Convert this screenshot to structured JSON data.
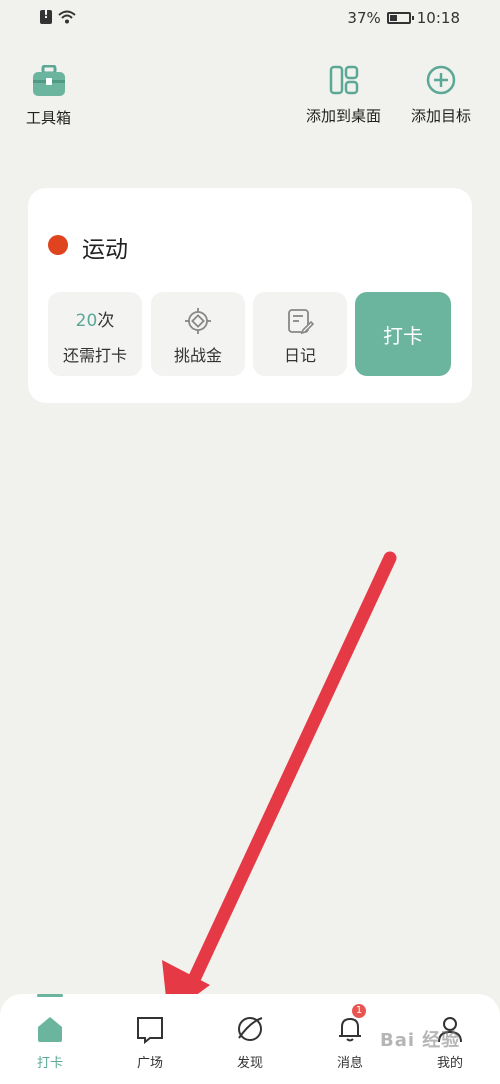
{
  "status": {
    "battery_text": "37%",
    "battery_level": 0.37,
    "time": "10:18"
  },
  "header": {
    "toolbox_label": "工具箱",
    "add_to_desktop_label": "添加到桌面",
    "add_goal_label": "添加目标"
  },
  "goal": {
    "name": "运动",
    "dot_color": "#e0441e",
    "remaining_count": "20",
    "remaining_unit": "次",
    "remaining_label": "还需打卡",
    "challenge_label": "挑战金",
    "diary_label": "日记",
    "checkin_label": "打卡"
  },
  "tabbar": {
    "items": [
      {
        "label": "打卡",
        "icon": "home-icon"
      },
      {
        "label": "广场",
        "icon": "bookmark-icon"
      },
      {
        "label": "发现",
        "icon": "planet-icon"
      },
      {
        "label": "消息",
        "icon": "bell-icon"
      },
      {
        "label": "我的",
        "icon": "person-icon"
      }
    ],
    "message_badge": "1"
  },
  "watermark": "Bai 经验",
  "colors": {
    "accent": "#6bb59e",
    "background": "#f1f1ed",
    "badge": "#e85550",
    "arrow": "#e63946"
  }
}
